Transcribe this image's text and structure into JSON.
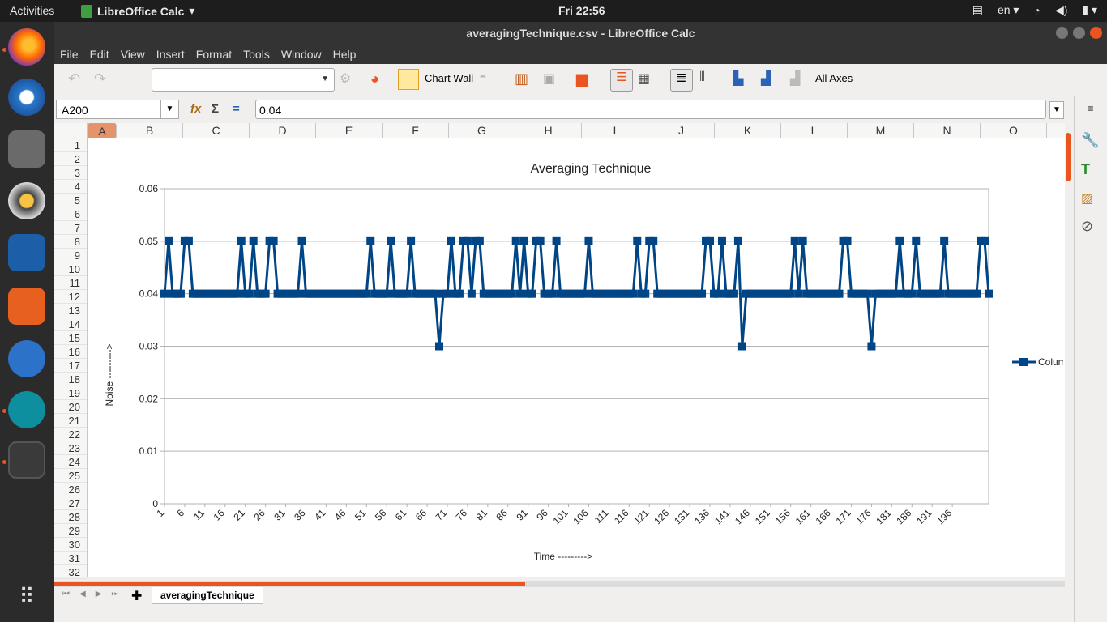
{
  "topbar": {
    "activities": "Activities",
    "app_name": "LibreOffice Calc",
    "clock": "Fri 22:56",
    "lang": "en"
  },
  "window": {
    "title": "averagingTechnique.csv - LibreOffice Calc"
  },
  "menu": [
    "File",
    "Edit",
    "View",
    "Insert",
    "Format",
    "Tools",
    "Window",
    "Help"
  ],
  "toolbar": {
    "chart_wall_label": "Chart Wall",
    "all_axes_label": "All Axes"
  },
  "formula": {
    "cell_ref": "A200",
    "value": "0.04"
  },
  "columns": [
    "A",
    "B",
    "C",
    "D",
    "E",
    "F",
    "G",
    "H",
    "I",
    "J",
    "K",
    "L",
    "M",
    "N",
    "O"
  ],
  "rows": [
    "1",
    "2",
    "3",
    "4",
    "5",
    "6",
    "7",
    "8",
    "9",
    "10",
    "11",
    "12",
    "13",
    "14",
    "15",
    "16",
    "17",
    "18",
    "19",
    "20",
    "21",
    "22",
    "23",
    "24",
    "25",
    "26",
    "27",
    "28",
    "29",
    "30",
    "31",
    "32"
  ],
  "sheet_tab": "averagingTechnique",
  "chart_data": {
    "type": "line",
    "title": "Averaging Technique",
    "xlabel": "Time --------->",
    "ylabel": "Noise --------->",
    "ylim": [
      0,
      0.06
    ],
    "yticks": [
      "0",
      "0.01",
      "0.02",
      "0.03",
      "0.04",
      "0.05",
      "0.06"
    ],
    "xtick_labels": [
      "1",
      "6",
      "11",
      "16",
      "21",
      "26",
      "31",
      "36",
      "41",
      "46",
      "51",
      "56",
      "61",
      "66",
      "71",
      "76",
      "81",
      "86",
      "91",
      "96",
      "101",
      "106",
      "111",
      "116",
      "121",
      "126",
      "131",
      "136",
      "141",
      "146",
      "151",
      "156",
      "161",
      "166",
      "171",
      "176",
      "181",
      "186",
      "191",
      "196"
    ],
    "grid": true,
    "legend": "right",
    "series": [
      {
        "name": "Colum",
        "color": "#004586",
        "values": [
          0.04,
          0.05,
          0.04,
          0.04,
          0.04,
          0.05,
          0.05,
          0.04,
          0.04,
          0.04,
          0.04,
          0.04,
          0.04,
          0.04,
          0.04,
          0.04,
          0.04,
          0.04,
          0.04,
          0.05,
          0.04,
          0.04,
          0.05,
          0.04,
          0.04,
          0.04,
          0.05,
          0.05,
          0.04,
          0.04,
          0.04,
          0.04,
          0.04,
          0.04,
          0.05,
          0.04,
          0.04,
          0.04,
          0.04,
          0.04,
          0.04,
          0.04,
          0.04,
          0.04,
          0.04,
          0.04,
          0.04,
          0.04,
          0.04,
          0.04,
          0.04,
          0.05,
          0.04,
          0.04,
          0.04,
          0.04,
          0.05,
          0.04,
          0.04,
          0.04,
          0.04,
          0.05,
          0.04,
          0.04,
          0.04,
          0.04,
          0.04,
          0.04,
          0.03,
          0.04,
          0.04,
          0.05,
          0.04,
          0.04,
          0.05,
          0.05,
          0.04,
          0.05,
          0.05,
          0.04,
          0.04,
          0.04,
          0.04,
          0.04,
          0.04,
          0.04,
          0.04,
          0.05,
          0.04,
          0.05,
          0.04,
          0.04,
          0.05,
          0.05,
          0.04,
          0.04,
          0.04,
          0.05,
          0.04,
          0.04,
          0.04,
          0.04,
          0.04,
          0.04,
          0.04,
          0.05,
          0.04,
          0.04,
          0.04,
          0.04,
          0.04,
          0.04,
          0.04,
          0.04,
          0.04,
          0.04,
          0.04,
          0.05,
          0.04,
          0.04,
          0.05,
          0.05,
          0.04,
          0.04,
          0.04,
          0.04,
          0.04,
          0.04,
          0.04,
          0.04,
          0.04,
          0.04,
          0.04,
          0.04,
          0.05,
          0.05,
          0.04,
          0.04,
          0.05,
          0.04,
          0.04,
          0.04,
          0.05,
          0.03,
          0.04,
          0.04,
          0.04,
          0.04,
          0.04,
          0.04,
          0.04,
          0.04,
          0.04,
          0.04,
          0.04,
          0.04,
          0.05,
          0.04,
          0.05,
          0.04,
          0.04,
          0.04,
          0.04,
          0.04,
          0.04,
          0.04,
          0.04,
          0.04,
          0.05,
          0.05,
          0.04,
          0.04,
          0.04,
          0.04,
          0.04,
          0.03,
          0.04,
          0.04,
          0.04,
          0.04,
          0.04,
          0.04,
          0.05,
          0.04,
          0.04,
          0.04,
          0.05,
          0.04,
          0.04,
          0.04,
          0.04,
          0.04,
          0.04,
          0.05,
          0.04,
          0.04,
          0.04,
          0.04,
          0.04,
          0.04,
          0.04,
          0.04,
          0.05,
          0.05,
          0.04
        ]
      }
    ]
  }
}
